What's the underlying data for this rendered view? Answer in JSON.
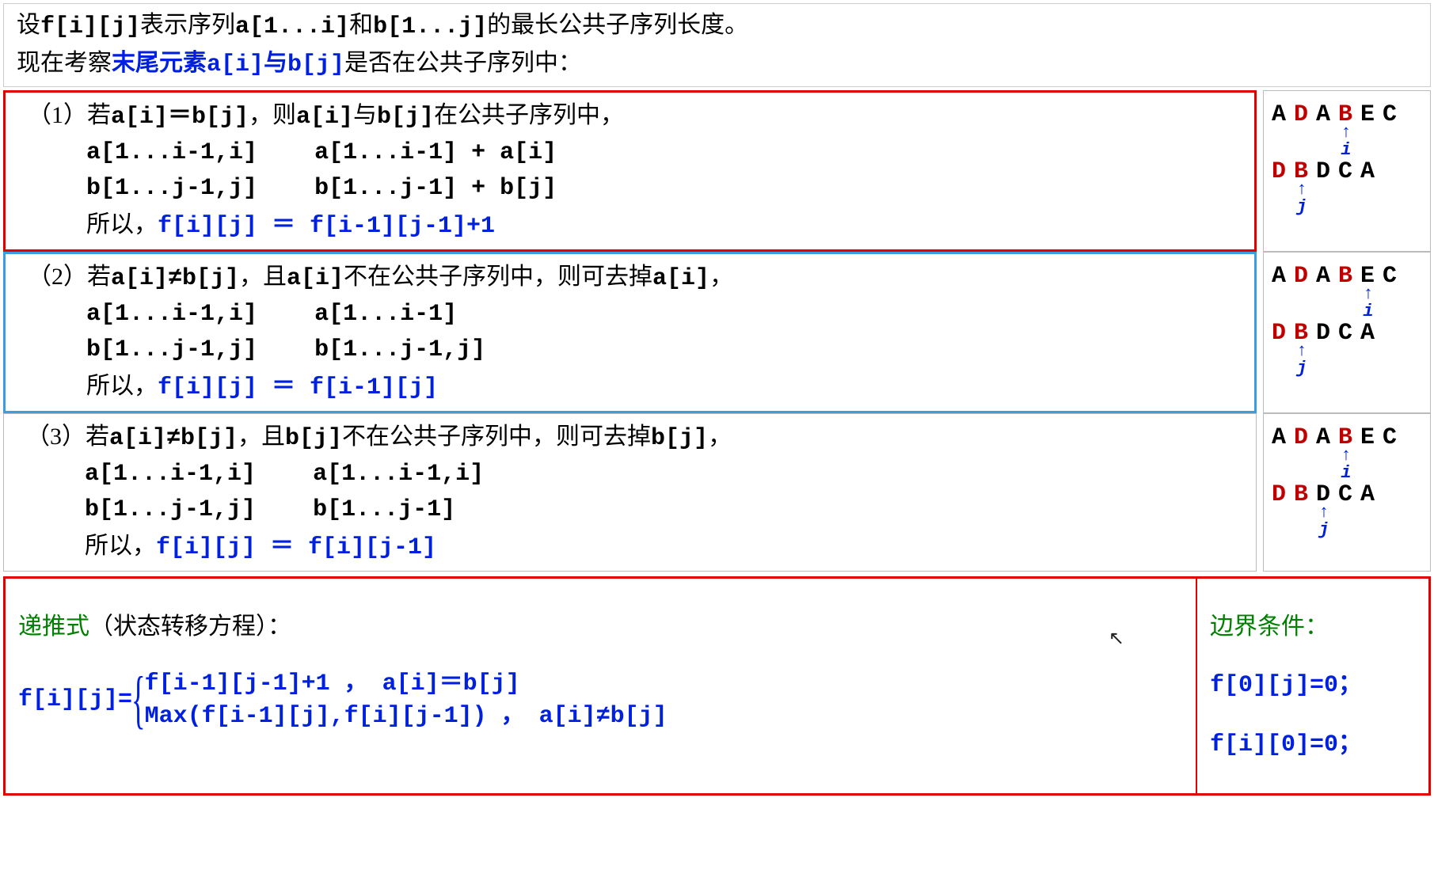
{
  "intro": {
    "line1_a": "设",
    "line1_b": "f[i][j]",
    "line1_c": "表示序列",
    "line1_d": "a[1...i]",
    "line1_e": "和",
    "line1_f": "b[1...j]",
    "line1_g": "的最长公共子序列长度。",
    "line2_a": "现在考察",
    "line2_b": "末尾元素a[i]与b[j]",
    "line2_c": "是否在公共子序列中："
  },
  "case1": {
    "head_a": "（1）若",
    "head_b": "a[i]＝b[j]",
    "head_c": "，则",
    "head_d": "a[i]",
    "head_e": "与",
    "head_f": "b[j]",
    "head_g": "在公共子序列中，",
    "row_a_left": "a[1...i-1,i]",
    "row_a_right": "a[1...i-1] + a[i]",
    "row_b_left": "b[1...j-1,j]",
    "row_b_right": "b[1...j-1] + b[j]",
    "conc_a": "所以，",
    "conc_b": "f[i][j] ＝ f[i-1][j-1]+1"
  },
  "case2": {
    "head_a": "（2）若",
    "head_b": "a[i]≠b[j]",
    "head_c": "，且",
    "head_d": "a[i]",
    "head_e": "不在公共子序列中，则可去掉",
    "head_f": "a[i]",
    "head_g": "，",
    "row_a_left": "a[1...i-1,i]",
    "row_a_right": "a[1...i-1]",
    "row_b_left": "b[1...j-1,j]",
    "row_b_right": "b[1...j-1,j]",
    "conc_a": "所以，",
    "conc_b": "f[i][j] ＝ f[i-1][j]"
  },
  "case3": {
    "head_a": "（3）若",
    "head_b": "a[i]≠b[j]",
    "head_c": "，且",
    "head_d": "b[j]",
    "head_e": "不在公共子序列中，则可去掉",
    "head_f": "b[j]",
    "head_g": "，",
    "row_a_left": "a[1...i-1,i]",
    "row_a_right": "a[1...i-1,i]",
    "row_b_left": "b[1...j-1,j]",
    "row_b_right": "b[1...j-1]",
    "conc_a": "所以，",
    "conc_b": "f[i][j] ＝ f[i][j-1]"
  },
  "example_seq": {
    "a": [
      "A",
      "D",
      "A",
      "B",
      "E",
      "C"
    ],
    "b": [
      "D",
      "B",
      "D",
      "C",
      "A"
    ],
    "a_red_idx": {
      "1": [
        1,
        3
      ],
      "2": [
        1,
        3
      ],
      "3": [
        1,
        3
      ]
    },
    "b_red_idx": {
      "1": [
        0,
        1
      ],
      "2": [
        0,
        1
      ],
      "3": [
        0,
        1
      ]
    },
    "i_pos": {
      "1": 3,
      "2": 4,
      "3": 3
    },
    "j_pos": {
      "1": 1,
      "2": 1,
      "3": 2
    }
  },
  "recurrence": {
    "title": "递推式",
    "title_suffix": "（状态转移方程）：",
    "lhs": "f[i][j]=",
    "rhs1": "f[i-1][j-1]+1 ，  a[i]＝b[j]",
    "rhs2": "Max(f[i-1][j],f[i][j-1]) ， a[i]≠b[j]"
  },
  "boundary": {
    "title": "边界条件：",
    "line1": "f[0][j]=0；",
    "line2": "f[i][0]=0；"
  },
  "labels": {
    "i": "i",
    "j": "j"
  }
}
